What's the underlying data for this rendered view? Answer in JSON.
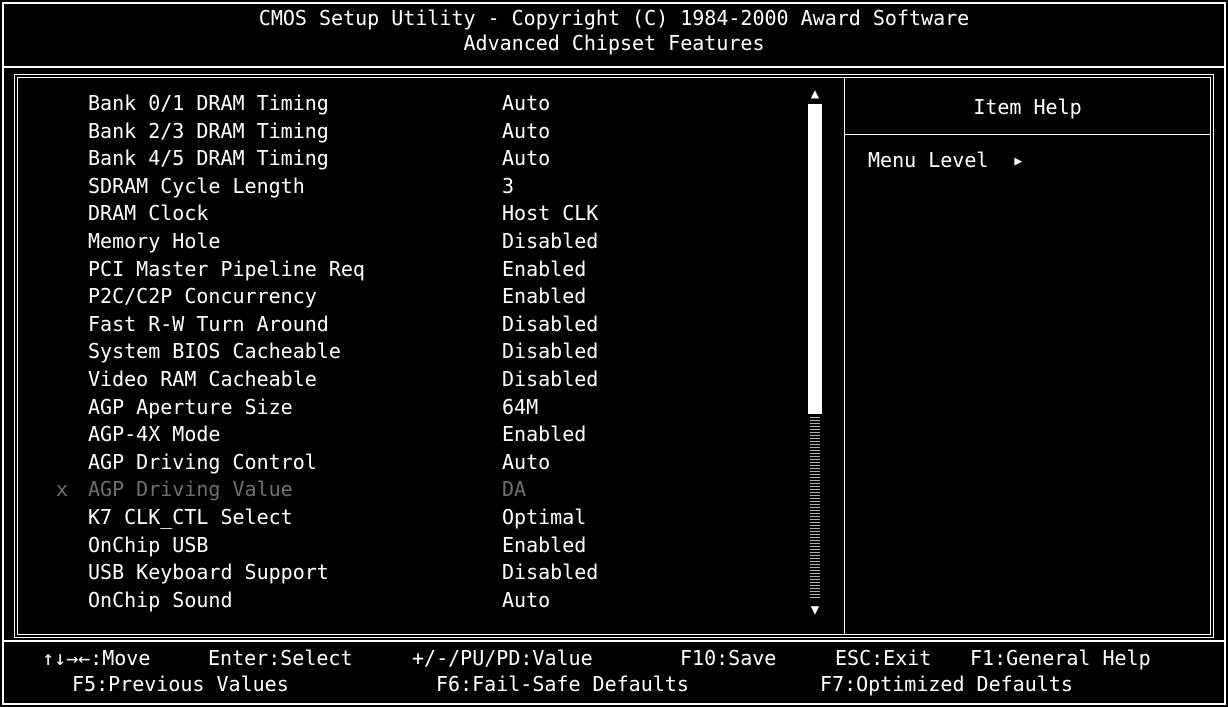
{
  "header": {
    "line1": "CMOS Setup Utility - Copyright (C) 1984-2000 Award Software",
    "line2": "Advanced Chipset Features"
  },
  "items": [
    {
      "label": "Bank 0/1 DRAM Timing",
      "value": "Auto"
    },
    {
      "label": "Bank 2/3 DRAM Timing",
      "value": "Auto"
    },
    {
      "label": "Bank 4/5 DRAM Timing",
      "value": "Auto"
    },
    {
      "label": "SDRAM Cycle Length",
      "value": "3"
    },
    {
      "label": "DRAM Clock",
      "value": "Host CLK"
    },
    {
      "label": "Memory Hole",
      "value": "Disabled"
    },
    {
      "label": "PCI Master Pipeline Req",
      "value": "Enabled"
    },
    {
      "label": "P2C/C2P Concurrency",
      "value": "Enabled"
    },
    {
      "label": "Fast R-W Turn Around",
      "value": "Disabled"
    },
    {
      "label": "System BIOS Cacheable",
      "value": "Disabled"
    },
    {
      "label": "Video RAM Cacheable",
      "value": "Disabled"
    },
    {
      "label": "AGP Aperture Size",
      "value": "64M"
    },
    {
      "label": "AGP-4X Mode",
      "value": "Enabled"
    },
    {
      "label": "AGP Driving Control",
      "value": "Auto"
    },
    {
      "label": "AGP Driving Value",
      "value": "DA",
      "mark": "x",
      "disabled": true
    },
    {
      "label": "K7 CLK_CTL Select",
      "value": "Optimal"
    },
    {
      "label": "OnChip USB",
      "value": "Enabled"
    },
    {
      "label": "USB Keyboard Support",
      "value": "Disabled"
    },
    {
      "label": "OnChip Sound",
      "value": "Auto"
    }
  ],
  "help": {
    "header": "Item Help",
    "menu_level_label": "Menu Level",
    "menu_level_arrow": "▶"
  },
  "scrollbar": {
    "up_arrow": "▲",
    "down_arrow": "▼"
  },
  "footer": {
    "move": "↑↓→←:Move",
    "enter": "Enter:Select",
    "value": "+/-/PU/PD:Value",
    "save": "F10:Save",
    "exit": "ESC:Exit",
    "help": "F1:General Help",
    "prev": "F5:Previous Values",
    "failsafe": "F6:Fail-Safe Defaults",
    "optimized": "F7:Optimized Defaults"
  },
  "colors": {
    "background": "#000000",
    "foreground": "#ffffff",
    "disabled": "#6f6f6f"
  }
}
